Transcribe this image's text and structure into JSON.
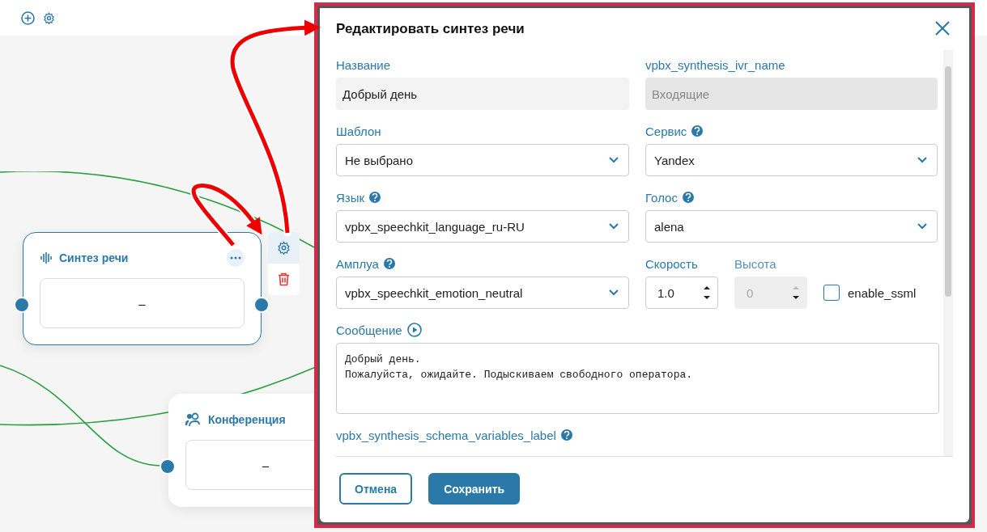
{
  "canvas": {
    "nodes": [
      {
        "kind": "synthesis",
        "title": "Синтез речи",
        "value": "–",
        "selected": true
      },
      {
        "kind": "conference",
        "title": "Конференция",
        "value": "–",
        "selected": false
      }
    ]
  },
  "modal": {
    "title": "Редактировать синтез речи",
    "fields": [
      {
        "kind": "text",
        "label": "Название",
        "value": "Добрый день",
        "help": false,
        "disabled": false
      },
      {
        "kind": "text",
        "label": "vpbx_synthesis_ivr_name",
        "value": "Входящие",
        "help": false,
        "disabled": true
      },
      {
        "kind": "select",
        "label": "Шаблон",
        "value": "Не выбрано",
        "help": false,
        "disabled": false
      },
      {
        "kind": "select",
        "label": "Сервис",
        "value": "Yandex",
        "help": true,
        "disabled": false
      },
      {
        "kind": "select",
        "label": "Язык",
        "value": "vpbx_speechkit_language_ru-RU",
        "help": true,
        "disabled": false
      },
      {
        "kind": "select",
        "label": "Голос",
        "value": "alena",
        "help": true,
        "disabled": false
      },
      {
        "kind": "select",
        "label": "Амплуа",
        "value": "vpbx_speechkit_emotion_neutral",
        "help": true,
        "disabled": false
      }
    ],
    "numbers": [
      {
        "label": "Скорость",
        "value": "1.0",
        "disabled": false
      },
      {
        "label": "Высота",
        "value": "0",
        "disabled": true
      }
    ],
    "ssml": {
      "label": "enable_ssml",
      "checked": false
    },
    "message": {
      "label": "Сообщение",
      "lines": [
        "Добрый день.",
        "Пожалуйста, ожидайте. Подыскиваем свободного оператора."
      ]
    },
    "variables_label": "vpbx_synthesis_schema_variables_label",
    "buttons": [
      {
        "label": "Отмена",
        "kind": "secondary"
      },
      {
        "label": "Сохранить",
        "kind": "primary"
      }
    ]
  }
}
